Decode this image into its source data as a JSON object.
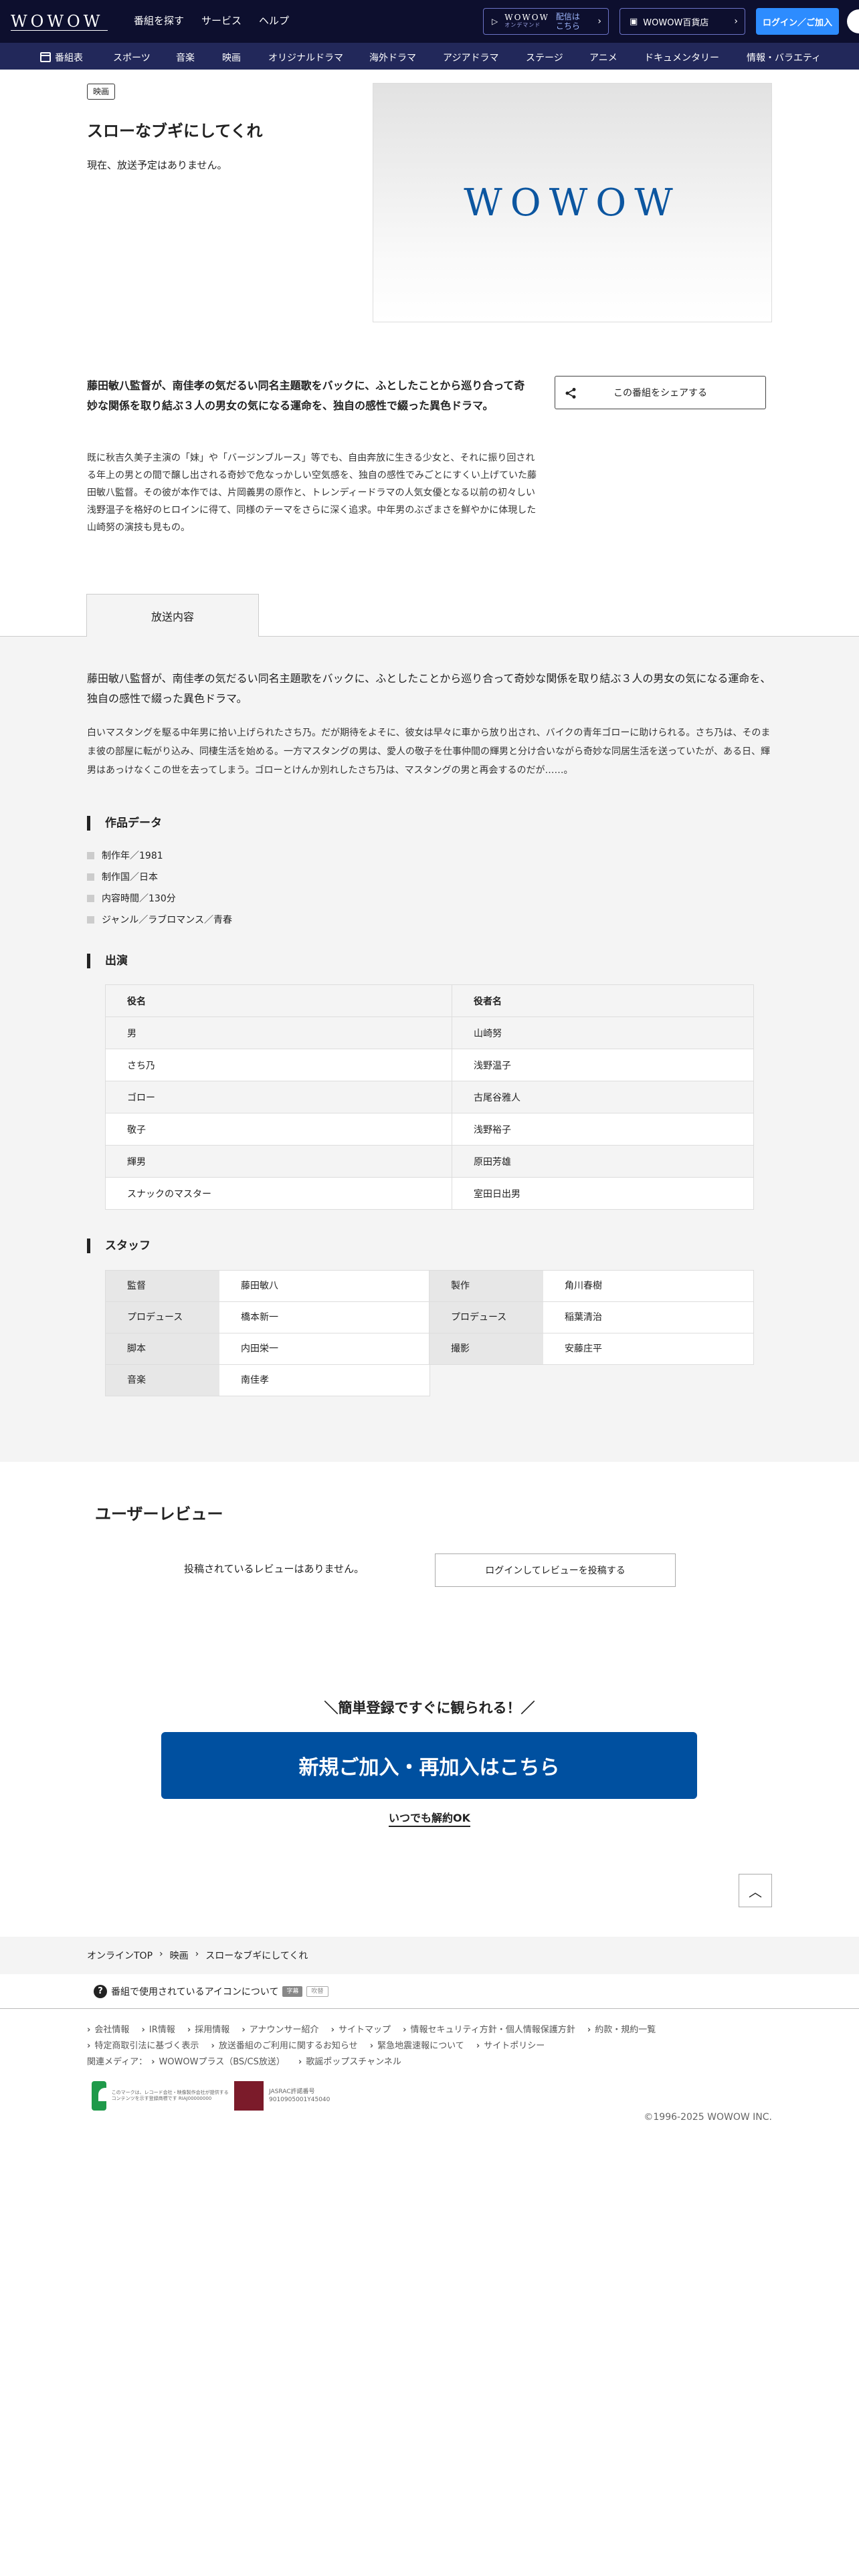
{
  "header": {
    "logo": "WOWOW",
    "nav": [
      "番組を探す",
      "サービス",
      "ヘルプ"
    ],
    "ondemand_logo": "WOWOW",
    "ondemand_sub": "オンデマンド",
    "ondemand_text_1": "配信は",
    "ondemand_text_2": "こちら",
    "shop_label": "WOWOW百貨店",
    "login_label": "ログイン／ご加入"
  },
  "subnav": [
    "番組表",
    "スポーツ",
    "音楽",
    "映画",
    "オリジナルドラマ",
    "海外ドラマ",
    "アジアドラマ",
    "ステージ",
    "アニメ",
    "ドキュメンタリー",
    "情報・バラエティ"
  ],
  "program": {
    "genre_tag": "映画",
    "title": "スローなブギにしてくれ",
    "schedule_note": "現在、放送予定はありません。",
    "image_logo": "WOWOW",
    "lead": "藤田敏八監督が、南佳孝の気だるい同名主題歌をバックに、ふとしたことから巡り合って奇妙な関係を取り結ぶ３人の男女の気になる運命を、独自の感性で綴った異色ドラマ。",
    "description": "既に秋吉久美子主演の「妹」や「バージンブルース」等でも、自由奔放に生きる少女と、それに振り回される年上の男との間で醸し出される奇妙で危なっかしい空気感を、独自の感性でみごとにすくい上げていた藤田敏八監督。その彼が本作では、片岡義男の原作と、トレンディードラマの人気女優となる以前の初々しい浅野温子を格好のヒロインに得て、同様のテーマをさらに深く追求。中年男のぶざまさを鮮やかに体現した山崎努の演技も見もの。",
    "share_label": "この番組をシェアする"
  },
  "tab": {
    "label": "放送内容"
  },
  "broadcast": {
    "lead": "藤田敏八監督が、南佳孝の気だるい同名主題歌をバックに、ふとしたことから巡り合って奇妙な関係を取り結ぶ３人の男女の気になる運命を、独自の感性で綴った異色ドラマ。",
    "story": "白いマスタングを駆る中年男に拾い上げられたさち乃。だが期待をよそに、彼女は早々に車から放り出され、バイクの青年ゴローに助けられる。さち乃は、そのまま彼の部屋に転がり込み、同棲生活を始める。一方マスタングの男は、愛人の敬子を仕事仲間の輝男と分け合いながら奇妙な同居生活を送っていたが、ある日、輝男はあっけなくこの世を去ってしまう。ゴローとけんか別れしたさち乃は、マスタングの男と再会するのだが……。"
  },
  "work_data": {
    "heading": "作品データ",
    "items": [
      "制作年／1981",
      "制作国／日本",
      "内容時間／130分",
      "ジャンル／ラブロマンス／青春"
    ]
  },
  "cast": {
    "heading": "出演",
    "col_role": "役名",
    "col_actor": "役者名",
    "rows": [
      {
        "role": "男",
        "actor": "山崎努"
      },
      {
        "role": "さち乃",
        "actor": "浅野温子"
      },
      {
        "role": "ゴロー",
        "actor": "古尾谷雅人"
      },
      {
        "role": "敬子",
        "actor": "浅野裕子"
      },
      {
        "role": "輝男",
        "actor": "原田芳雄"
      },
      {
        "role": "スナックのマスター",
        "actor": "室田日出男"
      }
    ]
  },
  "staff": {
    "heading": "スタッフ",
    "items": [
      {
        "k": "監督",
        "v": "藤田敏八"
      },
      {
        "k": "製作",
        "v": "角川春樹"
      },
      {
        "k": "プロデュース",
        "v": "橋本新一"
      },
      {
        "k": "プロデュース",
        "v": "稲葉清治"
      },
      {
        "k": "脚本",
        "v": "内田栄一"
      },
      {
        "k": "撮影",
        "v": "安藤庄平"
      },
      {
        "k": "音楽",
        "v": "南佳孝"
      }
    ]
  },
  "review": {
    "heading": "ユーザーレビュー",
    "empty": "投稿されているレビューはありません。",
    "button": "ログインしてレビューを投稿する"
  },
  "cta": {
    "catch": "＼簡単登録ですぐに観られる！／",
    "button": "新規ご加入・再加入はこちら",
    "sub": "いつでも解約OK"
  },
  "breadcrumb": [
    "オンラインTOP",
    "›",
    "映画",
    "›",
    "スローなブギにしてくれ"
  ],
  "icon_note": {
    "text": "番組で使用されているアイコンについて",
    "badge1": "字幕",
    "badge2": "吹替"
  },
  "footer": {
    "links": [
      "会社情報",
      "IR情報",
      "採用情報",
      "アナウンサー紹介",
      "サイトマップ",
      "情報セキュリティ方針・個人情報保護方針",
      "約款・規約一覧",
      "特定商取引法に基づく表示",
      "放送番組のご利用に関するお知らせ",
      "緊急地震速報について",
      "サイトポリシー"
    ],
    "related_label": "関連メディア：",
    "related": [
      "WOWOWプラス（BS/CS放送）",
      "歌謡ポップスチャンネル"
    ],
    "cert1_text": "このマークは、レコード会社・映像製作会社が提供するコンテンツを示す登録商標です RIAJ00000000",
    "cert2_line1": "JASRAC許諾番号",
    "cert2_line2": "9010905001Y45040",
    "copyright": "©1996-2025 WOWOW INC."
  }
}
